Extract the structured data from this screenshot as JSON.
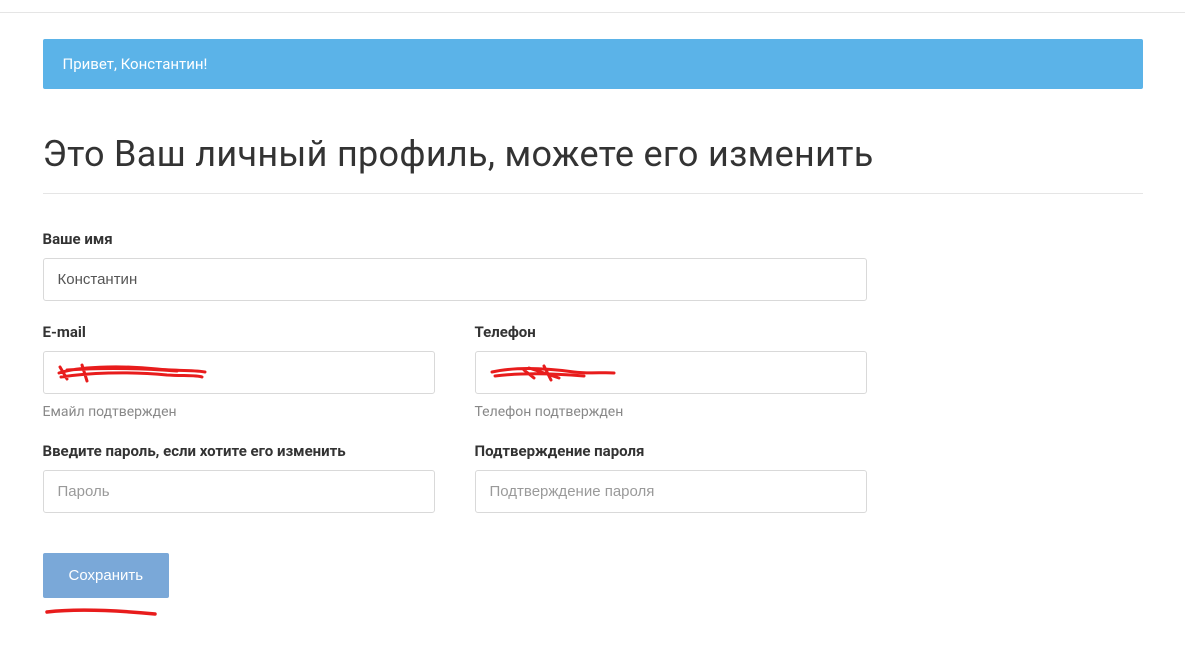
{
  "alert": {
    "greeting": "Привет, Константин!"
  },
  "page": {
    "title": "Это Ваш личный профиль, можете его изменить"
  },
  "form": {
    "name": {
      "label": "Ваше имя",
      "value": "Константин"
    },
    "email": {
      "label": "E-mail",
      "value": "",
      "helper": "Емайл подтвержден"
    },
    "phone": {
      "label": "Телефон",
      "value": "",
      "helper": "Телефон подтвержден"
    },
    "password": {
      "label": "Введите пароль, если хотите его изменить",
      "placeholder": "Пароль"
    },
    "password_confirm": {
      "label": "Подтверждение пароля",
      "placeholder": "Подтверждение пароля"
    },
    "save_label": "Сохранить"
  },
  "colors": {
    "banner_bg": "#5bb3e8",
    "button_bg": "#7aa8d8",
    "annotation": "#e81c1c"
  }
}
